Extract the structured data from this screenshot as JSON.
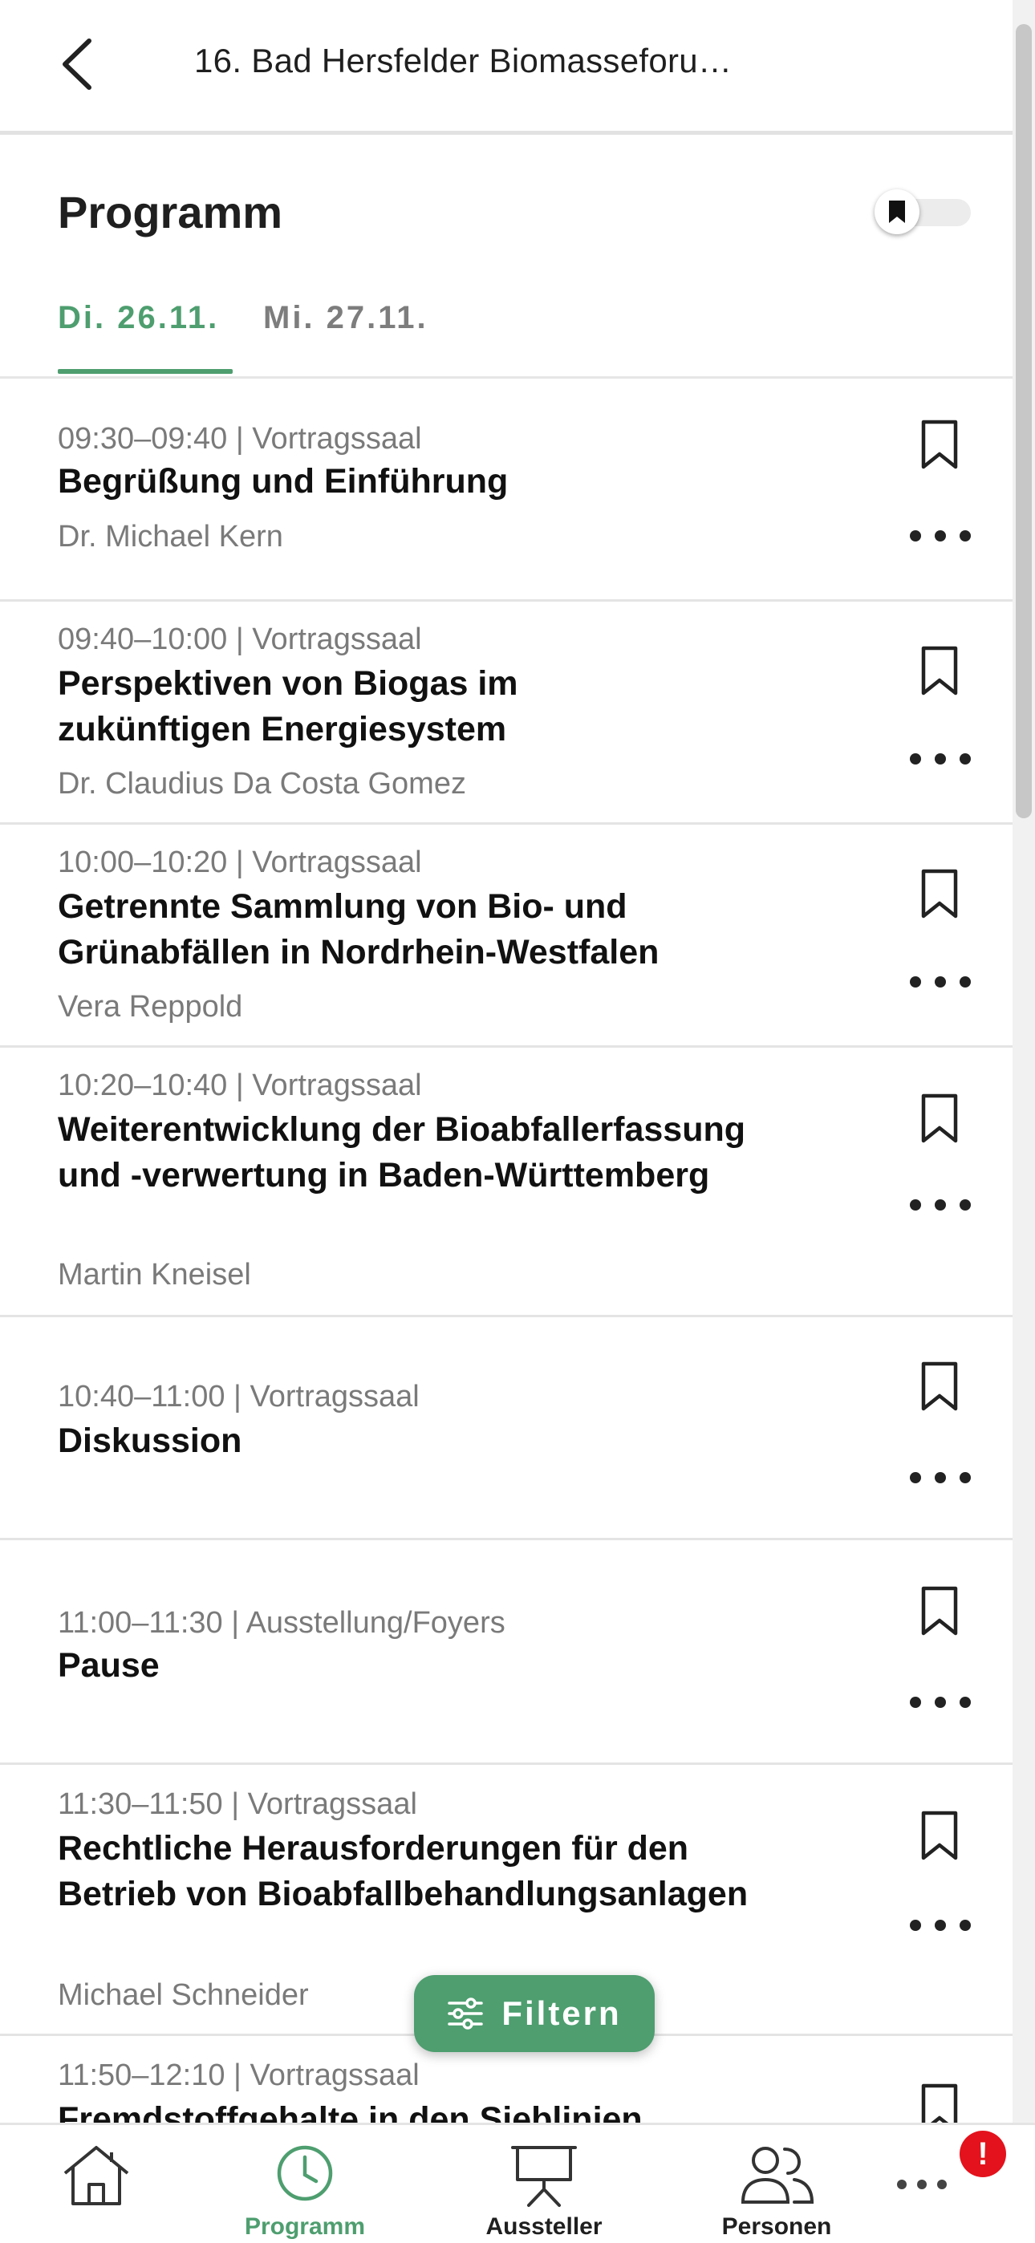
{
  "header": {
    "title": "16. Bad Hersfelder Biomasseforu…"
  },
  "section": {
    "title": "Programm"
  },
  "tabs": [
    {
      "label": "Di. 26.11."
    },
    {
      "label": "Mi. 27.11."
    }
  ],
  "sessions": [
    {
      "time": "09:30–09:40 | Vortragssaal",
      "title": "Begrüßung und Einführung",
      "speaker": "Dr. Michael Kern"
    },
    {
      "time": "09:40–10:00 | Vortragssaal",
      "title": "Perspektiven von Biogas im zukünftigen Energiesystem",
      "speaker": "Dr. Claudius Da Costa Gomez"
    },
    {
      "time": "10:00–10:20 | Vortragssaal",
      "title": "Getrennte Sammlung von Bio- und Grünabfällen in Nordrhein-Westfalen",
      "speaker": "Vera Reppold"
    },
    {
      "time": "10:20–10:40 | Vortragssaal",
      "title": "Weiterentwicklung der Bioabfallerfassung und -verwertung in Baden-Württemberg",
      "speaker": "Martin Kneisel"
    },
    {
      "time": "10:40–11:00 | Vortragssaal",
      "title": "Diskussion",
      "speaker": ""
    },
    {
      "time": "11:00–11:30 | Ausstellung/Foyers",
      "title": "Pause",
      "speaker": ""
    },
    {
      "time": "11:30–11:50 | Vortragssaal",
      "title": "Rechtliche Herausforderungen für den Betrieb von Bioabfallbehandlungsanlagen",
      "speaker": "Michael Schneider"
    },
    {
      "time": "11:50–12:10 | Vortragssaal",
      "title": "Fremdstoffgehalte in den Sieblinien",
      "speaker": ""
    }
  ],
  "fab": {
    "label": "Filtern"
  },
  "nav": {
    "items": [
      {
        "label": "",
        "icon": "home-icon"
      },
      {
        "label": "Programm",
        "icon": "clock-icon"
      },
      {
        "label": "Aussteller",
        "icon": "presentation-icon"
      },
      {
        "label": "Personen",
        "icon": "people-icon"
      },
      {
        "label": "",
        "icon": "more-icon"
      }
    ],
    "badge": "!"
  },
  "colors": {
    "accent": "#4e9e6f",
    "badge": "#e3121c"
  }
}
